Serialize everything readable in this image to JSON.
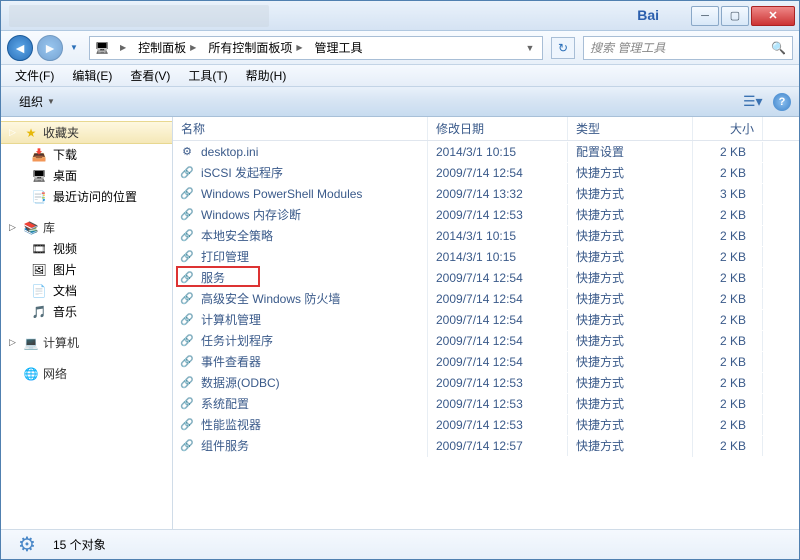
{
  "titlebar": {
    "logo": "Bai"
  },
  "nav": {
    "crumb_root_icon": "🖥",
    "crumbs": [
      "控制面板",
      "所有控制面板项",
      "管理工具"
    ]
  },
  "search": {
    "placeholder": "搜索 管理工具"
  },
  "menu": {
    "file": "文件(F)",
    "edit": "编辑(E)",
    "view": "查看(V)",
    "tools": "工具(T)",
    "help": "帮助(H)"
  },
  "toolbar": {
    "organize": "组织"
  },
  "sidebar": {
    "favorites": {
      "label": "收藏夹",
      "icon": "★",
      "items": [
        {
          "label": "下载",
          "icon": "📥"
        },
        {
          "label": "桌面",
          "icon": "🖥"
        },
        {
          "label": "最近访问的位置",
          "icon": "📑"
        }
      ]
    },
    "libraries": {
      "label": "库",
      "icon": "📚",
      "items": [
        {
          "label": "视频",
          "icon": "🎞"
        },
        {
          "label": "图片",
          "icon": "🖼"
        },
        {
          "label": "文档",
          "icon": "📄"
        },
        {
          "label": "音乐",
          "icon": "🎵"
        }
      ]
    },
    "computer": {
      "label": "计算机",
      "icon": "💻"
    },
    "network": {
      "label": "网络",
      "icon": "🌐"
    }
  },
  "columns": {
    "name": "名称",
    "date": "修改日期",
    "type": "类型",
    "size": "大小"
  },
  "files": [
    {
      "name": "desktop.ini",
      "date": "2014/3/1 10:15",
      "type": "配置设置",
      "size": "2 KB",
      "icon": "⚙"
    },
    {
      "name": "iSCSI 发起程序",
      "date": "2009/7/14 12:54",
      "type": "快捷方式",
      "size": "2 KB",
      "icon": "🔗"
    },
    {
      "name": "Windows PowerShell Modules",
      "date": "2009/7/14 13:32",
      "type": "快捷方式",
      "size": "3 KB",
      "icon": "🔗"
    },
    {
      "name": "Windows 内存诊断",
      "date": "2009/7/14 12:53",
      "type": "快捷方式",
      "size": "2 KB",
      "icon": "🔗"
    },
    {
      "name": "本地安全策略",
      "date": "2014/3/1 10:15",
      "type": "快捷方式",
      "size": "2 KB",
      "icon": "🔗"
    },
    {
      "name": "打印管理",
      "date": "2014/3/1 10:15",
      "type": "快捷方式",
      "size": "2 KB",
      "icon": "🔗"
    },
    {
      "name": "服务",
      "date": "2009/7/14 12:54",
      "type": "快捷方式",
      "size": "2 KB",
      "icon": "🔗",
      "highlight": true
    },
    {
      "name": "高级安全 Windows 防火墙",
      "date": "2009/7/14 12:54",
      "type": "快捷方式",
      "size": "2 KB",
      "icon": "🔗"
    },
    {
      "name": "计算机管理",
      "date": "2009/7/14 12:54",
      "type": "快捷方式",
      "size": "2 KB",
      "icon": "🔗"
    },
    {
      "name": "任务计划程序",
      "date": "2009/7/14 12:54",
      "type": "快捷方式",
      "size": "2 KB",
      "icon": "🔗"
    },
    {
      "name": "事件查看器",
      "date": "2009/7/14 12:54",
      "type": "快捷方式",
      "size": "2 KB",
      "icon": "🔗"
    },
    {
      "name": "数据源(ODBC)",
      "date": "2009/7/14 12:53",
      "type": "快捷方式",
      "size": "2 KB",
      "icon": "🔗"
    },
    {
      "name": "系统配置",
      "date": "2009/7/14 12:53",
      "type": "快捷方式",
      "size": "2 KB",
      "icon": "🔗"
    },
    {
      "name": "性能监视器",
      "date": "2009/7/14 12:53",
      "type": "快捷方式",
      "size": "2 KB",
      "icon": "🔗"
    },
    {
      "name": "组件服务",
      "date": "2009/7/14 12:57",
      "type": "快捷方式",
      "size": "2 KB",
      "icon": "🔗"
    }
  ],
  "status": {
    "count_text": "15 个对象"
  }
}
